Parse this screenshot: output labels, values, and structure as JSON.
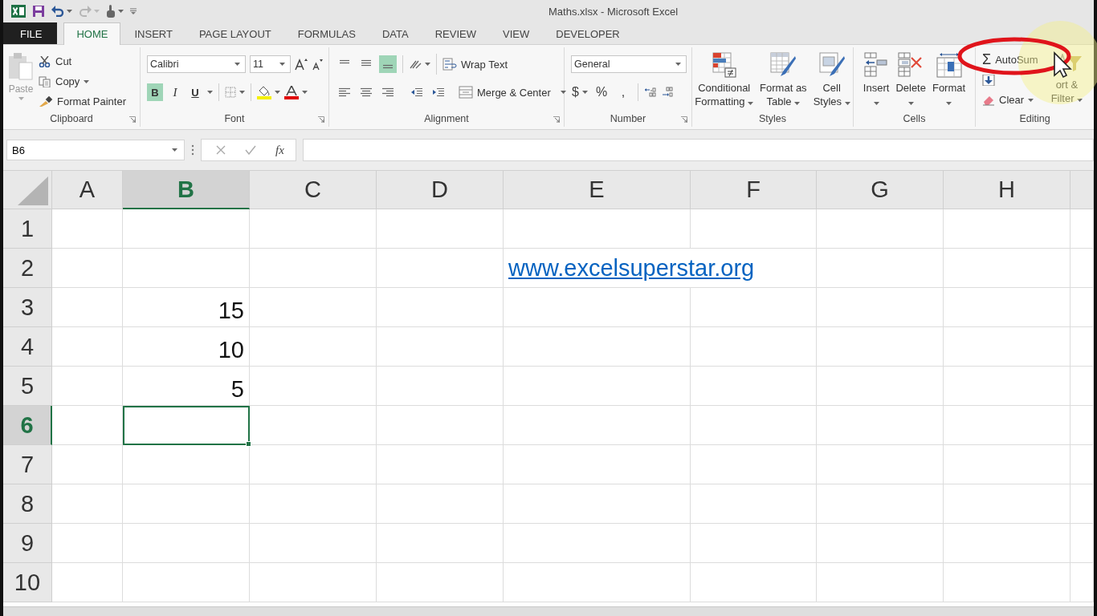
{
  "window": {
    "title": "Maths.xlsx - Microsoft Excel"
  },
  "tabs": [
    {
      "label": "FILE",
      "kind": "file",
      "selected": false
    },
    {
      "label": "HOME",
      "kind": "tab",
      "selected": true
    },
    {
      "label": "INSERT",
      "kind": "tab",
      "selected": false
    },
    {
      "label": "PAGE LAYOUT",
      "kind": "tab",
      "selected": false
    },
    {
      "label": "FORMULAS",
      "kind": "tab",
      "selected": false
    },
    {
      "label": "DATA",
      "kind": "tab",
      "selected": false
    },
    {
      "label": "REVIEW",
      "kind": "tab",
      "selected": false
    },
    {
      "label": "VIEW",
      "kind": "tab",
      "selected": false
    },
    {
      "label": "DEVELOPER",
      "kind": "tab",
      "selected": false
    }
  ],
  "ribbon": {
    "groups": [
      {
        "kind": "clipboard",
        "label": "Clipboard",
        "paste": "Paste",
        "cut": "Cut",
        "copy": "Copy",
        "format_painter": "Format Painter"
      },
      {
        "kind": "font",
        "label": "Font",
        "font_name": "Calibri",
        "font_size": "11",
        "bold_label": "B",
        "italic_label": "I",
        "underline_label": "U",
        "bold": true,
        "italic": false,
        "underline": false
      },
      {
        "kind": "alignment",
        "label": "Alignment",
        "wrap_text": "Wrap Text",
        "merge_center": "Merge & Center",
        "bottom_align": true
      },
      {
        "kind": "number",
        "label": "Number",
        "format": "General",
        "currency": "$",
        "percent": "%",
        "comma": ","
      },
      {
        "kind": "styles",
        "label": "Styles",
        "buttons": [
          {
            "lines": [
              "Conditional",
              "Formatting"
            ]
          },
          {
            "lines": [
              "Format as",
              "Table"
            ]
          },
          {
            "lines": [
              "Cell",
              "Styles"
            ]
          }
        ]
      },
      {
        "kind": "cells",
        "label": "Cells",
        "buttons": [
          "Insert",
          "Delete",
          "Format"
        ]
      },
      {
        "kind": "editing",
        "label": "Editing",
        "autosum_symbol": "Σ",
        "autosum": "AutoSum",
        "clear": "Clear",
        "sort_filter": [
          "ort &",
          "Filter"
        ]
      }
    ]
  },
  "formula_bar": {
    "name_box": "B6",
    "function_symbol": "fx"
  },
  "sheet": {
    "columns": [
      {
        "label": "A",
        "selected": false
      },
      {
        "label": "B",
        "selected": true
      },
      {
        "label": "C",
        "selected": false
      },
      {
        "label": "D",
        "selected": false
      },
      {
        "label": "E",
        "selected": false
      },
      {
        "label": "F",
        "selected": false
      },
      {
        "label": "G",
        "selected": false
      },
      {
        "label": "H",
        "selected": false
      }
    ],
    "rows": [
      {
        "label": "1",
        "selected": false,
        "cells": [
          {
            "kind": "empty",
            "selected": false
          },
          {
            "kind": "empty",
            "selected": false
          },
          {
            "kind": "empty",
            "selected": false
          },
          {
            "kind": "empty",
            "selected": false
          },
          {
            "kind": "empty",
            "selected": false
          },
          {
            "kind": "empty",
            "selected": false
          },
          {
            "kind": "empty",
            "selected": false
          },
          {
            "kind": "empty",
            "selected": false
          }
        ]
      },
      {
        "label": "2",
        "selected": false,
        "cells": [
          {
            "kind": "empty",
            "selected": false
          },
          {
            "kind": "empty",
            "selected": false
          },
          {
            "kind": "empty",
            "selected": false
          },
          {
            "kind": "empty",
            "selected": false
          },
          {
            "kind": "link",
            "value": "www.excelsuperstar.org",
            "selected": false
          },
          {
            "kind": "empty",
            "selected": false
          },
          {
            "kind": "empty",
            "selected": false
          }
        ]
      },
      {
        "label": "3",
        "selected": false,
        "cells": [
          {
            "kind": "empty",
            "selected": false
          },
          {
            "kind": "number",
            "value": "15",
            "selected": false
          },
          {
            "kind": "empty",
            "selected": false
          },
          {
            "kind": "empty",
            "selected": false
          },
          {
            "kind": "empty",
            "selected": false
          },
          {
            "kind": "empty",
            "selected": false
          },
          {
            "kind": "empty",
            "selected": false
          },
          {
            "kind": "empty",
            "selected": false
          }
        ]
      },
      {
        "label": "4",
        "selected": false,
        "cells": [
          {
            "kind": "empty",
            "selected": false
          },
          {
            "kind": "number",
            "value": "10",
            "selected": false
          },
          {
            "kind": "empty",
            "selected": false
          },
          {
            "kind": "empty",
            "selected": false
          },
          {
            "kind": "empty",
            "selected": false
          },
          {
            "kind": "empty",
            "selected": false
          },
          {
            "kind": "empty",
            "selected": false
          },
          {
            "kind": "empty",
            "selected": false
          }
        ]
      },
      {
        "label": "5",
        "selected": false,
        "cells": [
          {
            "kind": "empty",
            "selected": false
          },
          {
            "kind": "number",
            "value": "5",
            "selected": false
          },
          {
            "kind": "empty",
            "selected": false
          },
          {
            "kind": "empty",
            "selected": false
          },
          {
            "kind": "empty",
            "selected": false
          },
          {
            "kind": "empty",
            "selected": false
          },
          {
            "kind": "empty",
            "selected": false
          },
          {
            "kind": "empty",
            "selected": false
          }
        ]
      },
      {
        "label": "6",
        "selected": true,
        "cells": [
          {
            "kind": "empty",
            "selected": false
          },
          {
            "kind": "empty",
            "selected": true
          },
          {
            "kind": "empty",
            "selected": false
          },
          {
            "kind": "empty",
            "selected": false
          },
          {
            "kind": "empty",
            "selected": false
          },
          {
            "kind": "empty",
            "selected": false
          },
          {
            "kind": "empty",
            "selected": false
          },
          {
            "kind": "empty",
            "selected": false
          }
        ]
      },
      {
        "label": "7",
        "selected": false,
        "cells": [
          {
            "kind": "empty",
            "selected": false
          },
          {
            "kind": "empty",
            "selected": false
          },
          {
            "kind": "empty",
            "selected": false
          },
          {
            "kind": "empty",
            "selected": false
          },
          {
            "kind": "empty",
            "selected": false
          },
          {
            "kind": "empty",
            "selected": false
          },
          {
            "kind": "empty",
            "selected": false
          },
          {
            "kind": "empty",
            "selected": false
          }
        ]
      },
      {
        "label": "8",
        "selected": false,
        "cells": [
          {
            "kind": "empty",
            "selected": false
          },
          {
            "kind": "empty",
            "selected": false
          },
          {
            "kind": "empty",
            "selected": false
          },
          {
            "kind": "empty",
            "selected": false
          },
          {
            "kind": "empty",
            "selected": false
          },
          {
            "kind": "empty",
            "selected": false
          },
          {
            "kind": "empty",
            "selected": false
          },
          {
            "kind": "empty",
            "selected": false
          }
        ]
      },
      {
        "label": "9",
        "selected": false,
        "cells": [
          {
            "kind": "empty",
            "selected": false
          },
          {
            "kind": "empty",
            "selected": false
          },
          {
            "kind": "empty",
            "selected": false
          },
          {
            "kind": "empty",
            "selected": false
          },
          {
            "kind": "empty",
            "selected": false
          },
          {
            "kind": "empty",
            "selected": false
          },
          {
            "kind": "empty",
            "selected": false
          },
          {
            "kind": "empty",
            "selected": false
          }
        ]
      },
      {
        "label": "10",
        "selected": false,
        "cells": [
          {
            "kind": "empty",
            "selected": false
          },
          {
            "kind": "empty",
            "selected": false
          },
          {
            "kind": "empty",
            "selected": false
          },
          {
            "kind": "empty",
            "selected": false
          },
          {
            "kind": "empty",
            "selected": false
          },
          {
            "kind": "empty",
            "selected": false
          },
          {
            "kind": "empty",
            "selected": false
          },
          {
            "kind": "empty",
            "selected": false
          }
        ]
      }
    ]
  }
}
